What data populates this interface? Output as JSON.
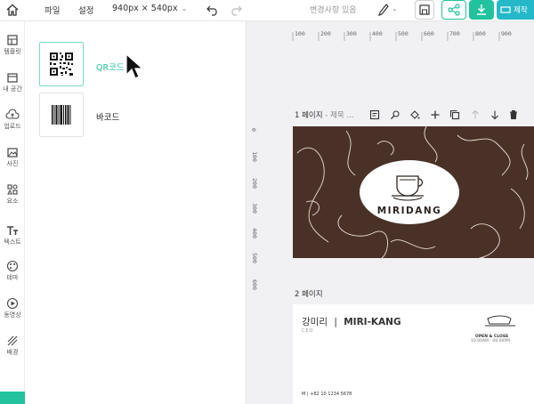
{
  "topbar": {
    "menu_file": "파일",
    "menu_settings": "설정",
    "size_label": "940px × 540px",
    "saved_status": "변경사항 있음",
    "make_label": "제작"
  },
  "rail": {
    "items": [
      {
        "label": "템플릿",
        "icon": "template-icon"
      },
      {
        "label": "내 공간",
        "icon": "folder-icon"
      },
      {
        "label": "업로드",
        "icon": "upload-icon"
      },
      {
        "label": "사진",
        "icon": "photo-icon"
      },
      {
        "label": "요소",
        "icon": "elements-icon"
      },
      {
        "label": "텍스트",
        "icon": "text-icon"
      },
      {
        "label": "테마",
        "icon": "palette-icon"
      },
      {
        "label": "동영상",
        "icon": "video-icon"
      },
      {
        "label": "배경",
        "icon": "background-icon"
      }
    ]
  },
  "panel": {
    "items": [
      {
        "label": "QR코드",
        "icon": "qr-code-icon"
      },
      {
        "label": "바코드",
        "icon": "barcode-icon"
      }
    ]
  },
  "canvas": {
    "ruler_top": [
      "100",
      "200",
      "300",
      "400",
      "500",
      "600",
      "700",
      "800",
      "900"
    ],
    "ruler_left": [
      "0",
      "100",
      "200",
      "300",
      "400",
      "500",
      "600"
    ],
    "page1_number": "1 페이지",
    "page1_name": " - 제목 ...",
    "page2_number": "2 페이지",
    "card1_brand": "MIRIDANG",
    "card2": {
      "name_kr": "강미리",
      "separator": "|",
      "name_en": "MIRI-KANG",
      "role": "CEO",
      "open_label": "OPEN & CLOSE",
      "hours": "10:00AM - 08:00PM",
      "phone": "M | +82 10 1234 5678"
    }
  },
  "colors": {
    "accent": "#22c29e",
    "make_button": "#25b8c9",
    "card_brown": "#4a3128"
  }
}
